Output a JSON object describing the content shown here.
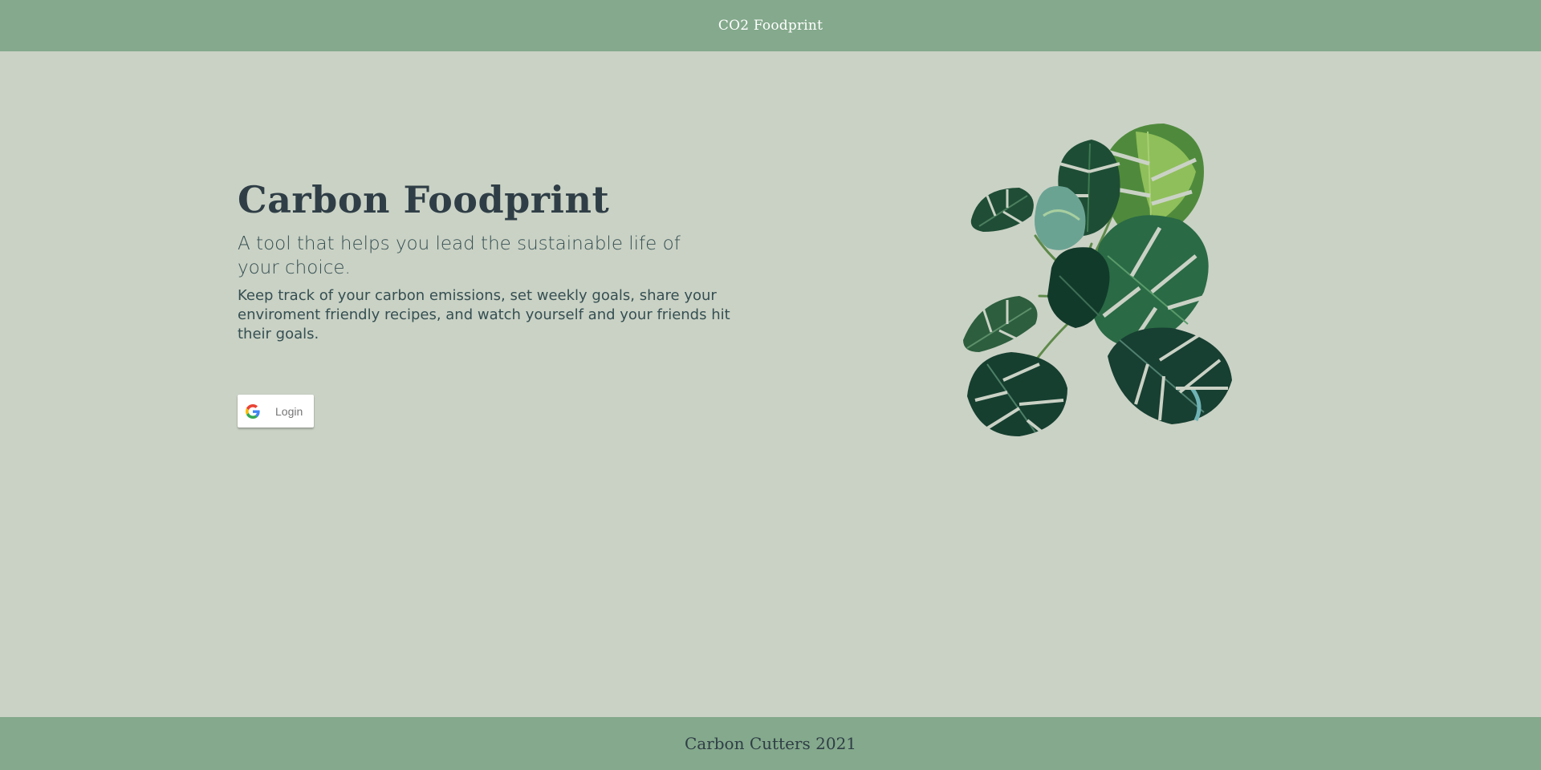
{
  "header": {
    "brand": "CO2 Foodprint"
  },
  "hero": {
    "title": "Carbon Foodprint",
    "subtitle": "A tool that helps you lead the sustainable life of your choice.",
    "description": "Keep track of your carbon emissions, set weekly goals, share your enviroment friendly recipes, and watch yourself and your friends hit their goals."
  },
  "login": {
    "label": "Login",
    "icon": "google-icon"
  },
  "illustration": {
    "icon": "monstera-plant-illustration"
  },
  "footer": {
    "credit": "Carbon Cutters 2021"
  },
  "colors": {
    "header_bg": "#84a98c",
    "page_bg": "#cad2c5",
    "title_text": "#2f3e46",
    "body_text": "#354f52"
  }
}
